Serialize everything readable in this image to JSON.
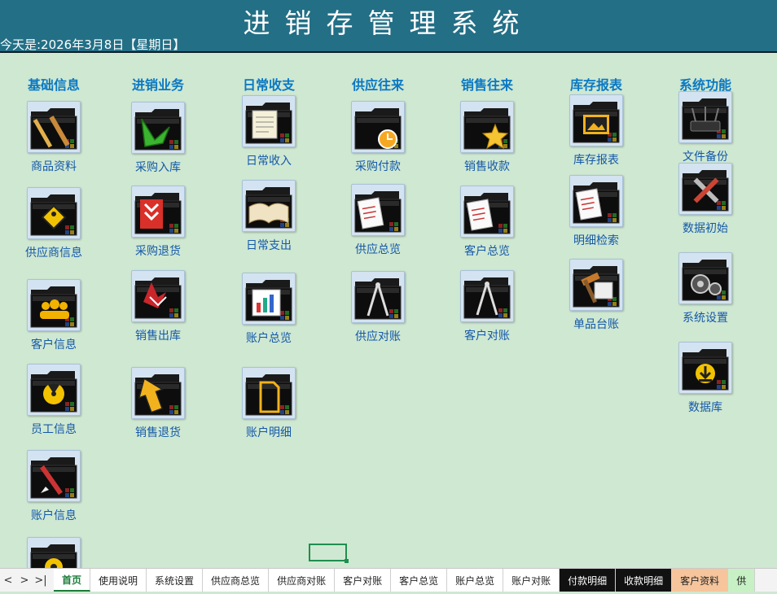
{
  "header": {
    "title": "进销存管理系统",
    "date_text": "今天是:2026年3月8日【星期日】"
  },
  "columns": [
    {
      "title": "基础信息",
      "items": [
        {
          "label": "商品资料",
          "icon": "pencil-ruler-folder-icon"
        },
        {
          "label": "供应商信息",
          "icon": "pedestrian-folder-icon"
        },
        {
          "label": "客户信息",
          "icon": "people-folder-icon"
        },
        {
          "label": "员工信息",
          "icon": "radiation-folder-icon"
        },
        {
          "label": "账户信息",
          "icon": "pen-folder-icon"
        },
        {
          "label": "",
          "icon": "gear-folder-icon"
        }
      ]
    },
    {
      "title": "进销业务",
      "items": [
        {
          "label": "采购入库",
          "icon": "green-arrow-folder-icon"
        },
        {
          "label": "采购退货",
          "icon": "red-arrow-folder-icon"
        },
        {
          "label": "销售出库",
          "icon": "red-star-folder-icon"
        },
        {
          "label": "销售退货",
          "icon": "yellow-arrow-folder-icon"
        }
      ]
    },
    {
      "title": "日常收支",
      "items": [
        {
          "label": "日常收入",
          "icon": "notepad-folder-icon"
        },
        {
          "label": "日常支出",
          "icon": "book-folder-icon"
        },
        {
          "label": "账户总览",
          "icon": "chart-folder-icon"
        },
        {
          "label": "账户明细",
          "icon": "document-folder-icon"
        }
      ]
    },
    {
      "title": "供应往来",
      "items": [
        {
          "label": "采购付款",
          "icon": "clock-folder-icon"
        },
        {
          "label": "供应总览",
          "icon": "pages-folder-icon"
        },
        {
          "label": "供应对账",
          "icon": "compass-folder-icon"
        }
      ]
    },
    {
      "title": "销售往来",
      "items": [
        {
          "label": "销售收款",
          "icon": "star-folder-icon"
        },
        {
          "label": "客户总览",
          "icon": "pages-folder-icon"
        },
        {
          "label": "客户对账",
          "icon": "compass-folder-icon"
        }
      ]
    },
    {
      "title": "库存报表",
      "items": [
        {
          "label": "库存报表",
          "icon": "picture-folder-icon"
        },
        {
          "label": "明细检索",
          "icon": "pages-folder-icon"
        },
        {
          "label": "单品台账",
          "icon": "hammer-folder-icon"
        }
      ]
    },
    {
      "title": "系统功能",
      "items": [
        {
          "label": "文件备份",
          "icon": "network-folder-icon"
        },
        {
          "label": "数据初始",
          "icon": "tools-folder-icon"
        },
        {
          "label": "系统设置",
          "icon": "gears-folder-icon"
        },
        {
          "label": "数据库",
          "icon": "download-folder-icon"
        }
      ]
    }
  ],
  "tabs": {
    "nav": [
      "<",
      ">",
      ">|"
    ],
    "sheets": [
      {
        "label": "首页",
        "active": true,
        "bg": "#ffffff",
        "fg": "#1c7c3a"
      },
      {
        "label": "使用说明",
        "bg": "#ffffff",
        "fg": "#222222"
      },
      {
        "label": "系统设置",
        "bg": "#ffffff",
        "fg": "#222222"
      },
      {
        "label": "供应商总览",
        "bg": "#ffffff",
        "fg": "#222222"
      },
      {
        "label": "供应商对账",
        "bg": "#ffffff",
        "fg": "#222222"
      },
      {
        "label": "客户对账",
        "bg": "#ffffff",
        "fg": "#222222"
      },
      {
        "label": "客户总览",
        "bg": "#ffffff",
        "fg": "#222222"
      },
      {
        "label": "账户总览",
        "bg": "#ffffff",
        "fg": "#222222"
      },
      {
        "label": "账户对账",
        "bg": "#ffffff",
        "fg": "#222222"
      },
      {
        "label": "付款明细",
        "bg": "#111111",
        "fg": "#ffffff"
      },
      {
        "label": "收款明细",
        "bg": "#111111",
        "fg": "#ffffff"
      },
      {
        "label": "客户资料",
        "bg": "#f6c59c",
        "fg": "#222222"
      },
      {
        "label": "供",
        "bg": "#c7f1c4",
        "fg": "#222222"
      }
    ]
  },
  "colors": {
    "header_bg": "#236f86",
    "page_bg": "#cfe8d2",
    "column_title": "#0a78c3",
    "tile_label": "#1458a8"
  }
}
